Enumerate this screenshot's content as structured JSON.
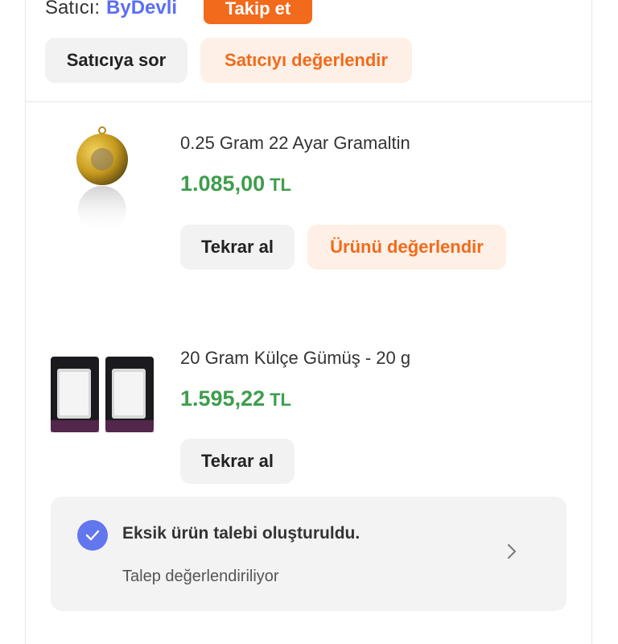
{
  "seller": {
    "prefix": "Satıcı:",
    "name": "ByDevli",
    "follow_label": "Takip et",
    "ask_label": "Satıcıya sor",
    "rate_label": "Satıcıyı değerlendir"
  },
  "products": [
    {
      "title": "0.25 Gram 22 Ayar Gramaltin",
      "price": "1.085,00",
      "currency": "TL",
      "buy_again_label": "Tekrar al",
      "rate_label": "Ürünü değerlendir"
    },
    {
      "title": "20 Gram Külçe Gümüş - 20 g",
      "price": "1.595,22",
      "currency": "TL",
      "buy_again_label": "Tekrar al"
    }
  ],
  "request": {
    "title": "Eksik ürün talebi oluşturuldu.",
    "status": "Talep değerlendiriliyor"
  },
  "colors": {
    "accent": "#f26a1b",
    "price": "#3f9d4d",
    "seller_link": "#5b6ef5",
    "check": "#6276ee"
  },
  "icons": [
    "check-icon",
    "chevron-right-icon"
  ]
}
